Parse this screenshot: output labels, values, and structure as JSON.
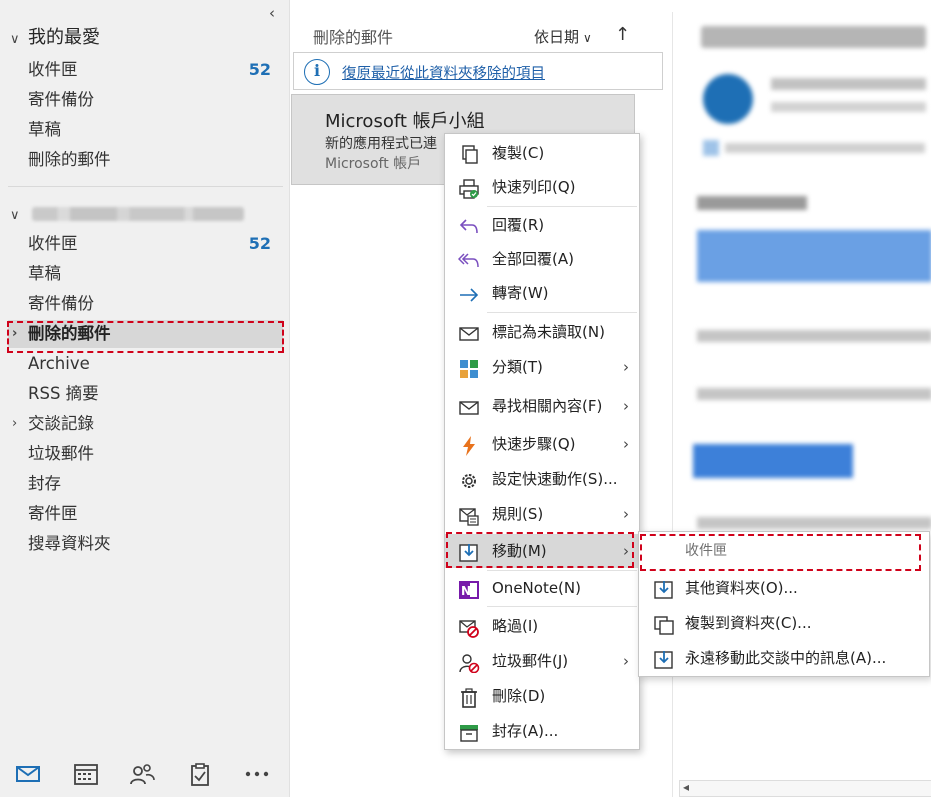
{
  "favorites": {
    "header": "我的最愛",
    "folders": [
      {
        "label": "收件匣",
        "count": "52"
      },
      {
        "label": "寄件備份"
      },
      {
        "label": "草稿"
      },
      {
        "label": "刪除的郵件"
      }
    ]
  },
  "account": {
    "folders": [
      {
        "label": "收件匣",
        "count": "52"
      },
      {
        "label": "草稿"
      },
      {
        "label": "寄件備份"
      },
      {
        "label": "刪除的郵件",
        "selected": true
      },
      {
        "label": "Archive"
      },
      {
        "label": "RSS 摘要"
      },
      {
        "label": "交談記錄"
      },
      {
        "label": "垃圾郵件"
      },
      {
        "label": "封存"
      },
      {
        "label": "寄件匣"
      },
      {
        "label": "搜尋資料夾"
      }
    ]
  },
  "nav": {
    "icons": [
      "mail-icon",
      "calendar-icon",
      "people-icon",
      "tasks-icon",
      "more-icon"
    ]
  },
  "message_list": {
    "title": "刪除的郵件",
    "sort_label": "依日期",
    "info_link": "復原最近從此資料夾移除的項目",
    "item": {
      "sender": "Microsoft 帳戶小組",
      "subject": "新的應用程式已連",
      "preview": "Microsoft 帳戶"
    }
  },
  "context_menu": {
    "items": [
      {
        "label": "複製(C)",
        "icon": "copy-icon"
      },
      {
        "label": "快速列印(Q)",
        "icon": "print-icon"
      },
      {
        "label": "回覆(R)",
        "icon": "reply-icon"
      },
      {
        "label": "全部回覆(A)",
        "icon": "reply-all-icon"
      },
      {
        "label": "轉寄(W)",
        "icon": "forward-icon"
      },
      {
        "label": "標記為未讀取(N)",
        "icon": "envelope-icon"
      },
      {
        "label": "分類(T)",
        "icon": "categorize-icon",
        "submenu": true
      },
      {
        "label": "尋找相關內容(F)",
        "icon": "find-related-icon",
        "submenu": true
      },
      {
        "label": "快速步驟(Q)",
        "icon": "lightning-icon",
        "submenu": true
      },
      {
        "label": "設定快速動作(S)...",
        "icon": "gear-icon"
      },
      {
        "label": "規則(S)",
        "icon": "rules-icon",
        "submenu": true
      },
      {
        "label": "移動(M)",
        "icon": "move-icon",
        "submenu": true,
        "active": true
      },
      {
        "label": "OneNote(N)",
        "icon": "onenote-icon"
      },
      {
        "label": "略過(I)",
        "icon": "ignore-icon"
      },
      {
        "label": "垃圾郵件(J)",
        "icon": "junk-icon",
        "submenu": true
      },
      {
        "label": "刪除(D)",
        "icon": "trash-icon"
      },
      {
        "label": "封存(A)...",
        "icon": "archive-icon"
      }
    ]
  },
  "sub_menu": {
    "items": [
      {
        "label": "收件匣",
        "disabled": true
      },
      {
        "label": "其他資料夾(O)...",
        "icon": "move-icon"
      },
      {
        "label": "複製到資料夾(C)...",
        "icon": "copy-to-folder-icon"
      },
      {
        "label": "永遠移動此交談中的訊息(A)...",
        "icon": "move-always-icon"
      }
    ]
  },
  "colors": {
    "accent": "#1e6fb5",
    "highlight_dash": "#d0021b",
    "onenote": "#7719aa",
    "lightning": "#e8721c"
  }
}
